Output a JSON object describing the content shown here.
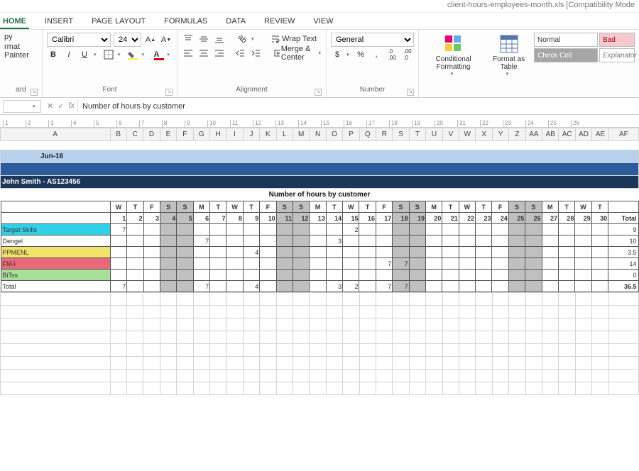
{
  "titlebar": "client-hours-employees-month.xls  [Compatibility Mode",
  "tabs": [
    "HOME",
    "INSERT",
    "PAGE LAYOUT",
    "FORMULAS",
    "DATA",
    "REVIEW",
    "VIEW"
  ],
  "active_tab": "HOME",
  "clipboard": {
    "copy": "py",
    "paste": "",
    "fmtpainter": "rmat Painter",
    "label": "ard"
  },
  "font": {
    "name": "Calibri",
    "size": "24",
    "label": "Font",
    "bold": "B",
    "italic": "I",
    "underline": "U"
  },
  "alignment": {
    "wrap": "Wrap Text",
    "merge": "Merge & Center",
    "label": "Alignment"
  },
  "number": {
    "format": "General",
    "label": "Number"
  },
  "styles": {
    "cond": "Conditional Formatting",
    "table": "Format as Table",
    "normal": "Normal",
    "bad": "Bad",
    "check": "Check Cell",
    "explan": "Explanator"
  },
  "fx": {
    "name": "",
    "formula": "Number of hours by customer"
  },
  "ruler_max": 26,
  "col_headers": [
    "A",
    "B",
    "C",
    "D",
    "E",
    "F",
    "G",
    "H",
    "I",
    "J",
    "K",
    "L",
    "M",
    "N",
    "O",
    "P",
    "Q",
    "R",
    "S",
    "T",
    "U",
    "V",
    "W",
    "X",
    "Y",
    "Z",
    "AA",
    "AB",
    "AC",
    "AD",
    "AE",
    "AF"
  ],
  "sheet": {
    "month": "Jun-16",
    "person": "John Smith -  AS123456",
    "title": "Number of hours by customer",
    "days_letters": [
      "W",
      "T",
      "F",
      "S",
      "S",
      "M",
      "T",
      "W",
      "T",
      "F",
      "S",
      "S",
      "M",
      "T",
      "W",
      "T",
      "F",
      "S",
      "S",
      "M",
      "T",
      "W",
      "T",
      "F",
      "S",
      "S",
      "M",
      "T",
      "W",
      "T"
    ],
    "days_nums": [
      1,
      2,
      3,
      4,
      5,
      6,
      7,
      8,
      9,
      10,
      11,
      12,
      13,
      14,
      15,
      16,
      17,
      18,
      19,
      20,
      21,
      22,
      23,
      24,
      25,
      26,
      27,
      28,
      29,
      30
    ],
    "weekend_idx": [
      3,
      4,
      10,
      11,
      17,
      18,
      24,
      25
    ],
    "total_label": "Total",
    "rows": [
      {
        "name": "Target Skills",
        "cls": "c-target",
        "cells": {
          "0": 7,
          "14": 2
        },
        "total": 9
      },
      {
        "name": "Dengel",
        "cls": "c-dengel",
        "cells": {
          "5": 7,
          "13": 3
        },
        "total": 10
      },
      {
        "name": "PPMENL",
        "cls": "c-ppmenl",
        "cells": {
          "8": 4
        },
        "total": 3.5
      },
      {
        "name": "FM-i",
        "cls": "c-fmi",
        "cells": {
          "16": 7,
          "17": 7
        },
        "total": 14
      },
      {
        "name": "BiTss",
        "cls": "c-bitss",
        "cells": {},
        "total": 0
      }
    ],
    "totals_row": {
      "name": "Total",
      "cells": {
        "0": 7,
        "5": 7,
        "8": 4,
        "13": 3,
        "14": 2,
        "16": 7,
        "17": 7
      },
      "total": 36.5
    }
  }
}
